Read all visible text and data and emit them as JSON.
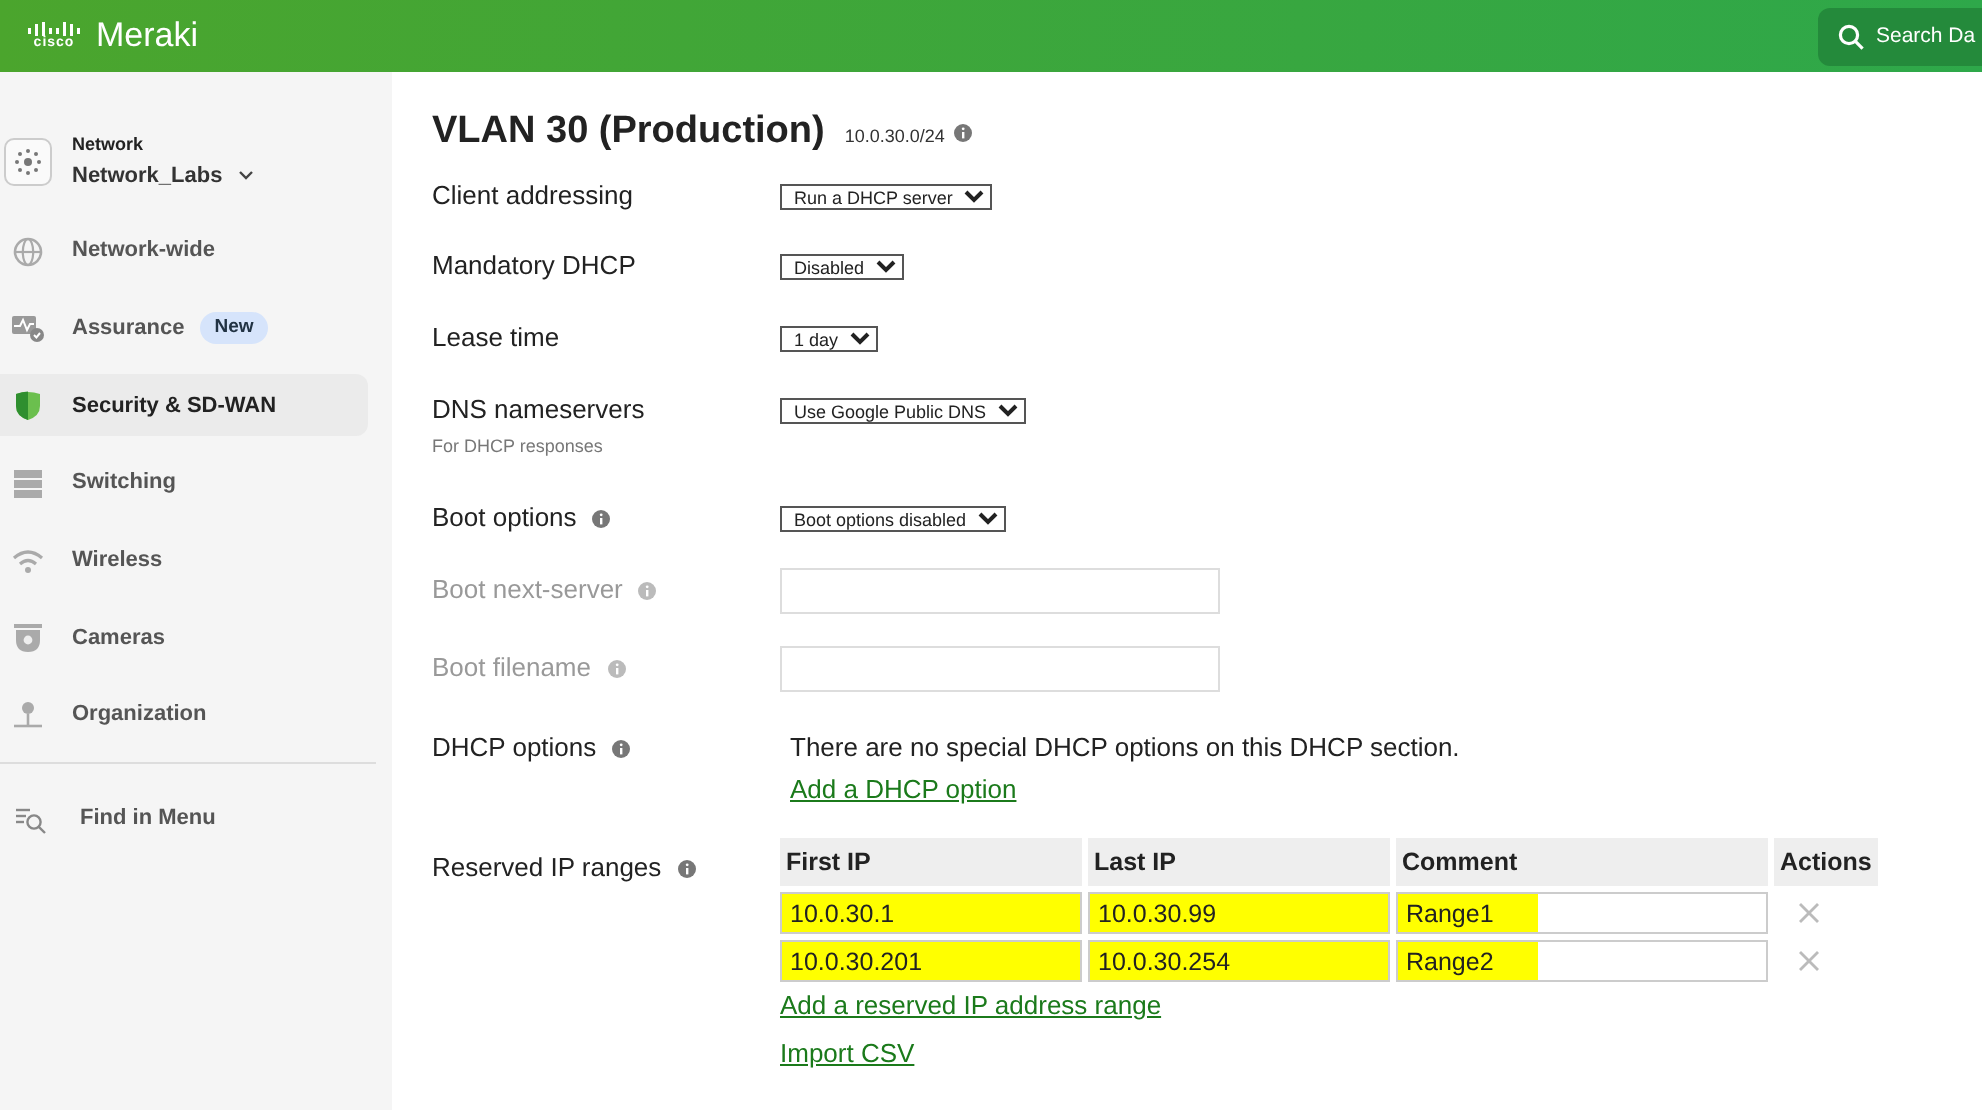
{
  "header": {
    "logo_mark": "cisco",
    "logo_name": "Meraki",
    "search": {
      "placeholder": "Search Da"
    }
  },
  "sidebar": {
    "network": {
      "label": "Network",
      "name": "Network_Labs"
    },
    "items": [
      {
        "label": "Network-wide",
        "selected": false
      },
      {
        "label": "Assurance",
        "selected": false,
        "badge": "New"
      },
      {
        "label": "Security & SD-WAN",
        "selected": true
      },
      {
        "label": "Switching",
        "selected": false
      },
      {
        "label": "Wireless",
        "selected": false
      },
      {
        "label": "Cameras",
        "selected": false
      },
      {
        "label": "Organization",
        "selected": false
      }
    ],
    "find": "Find in Menu"
  },
  "page": {
    "title": "VLAN 30 (Production)",
    "subnet": "10.0.30.0/24",
    "fields": [
      {
        "kind": "select",
        "label": "Client addressing",
        "value": "Run a DHCP server",
        "info": false,
        "disabled": false
      },
      {
        "kind": "select",
        "label": "Mandatory DHCP",
        "value": "Disabled",
        "info": false,
        "disabled": false
      },
      {
        "kind": "select",
        "label": "Lease time",
        "value": "1 day",
        "info": false,
        "disabled": false
      },
      {
        "kind": "select",
        "label": "DNS nameservers",
        "hint": "For DHCP responses",
        "value": "Use Google Public DNS",
        "info": false,
        "disabled": false
      },
      {
        "kind": "select",
        "label": "Boot options",
        "value": "Boot options disabled",
        "info": true,
        "disabled": false
      },
      {
        "kind": "text",
        "label": "Boot next-server",
        "info": true,
        "disabled": true
      },
      {
        "kind": "text",
        "label": "Boot filename",
        "info": true,
        "disabled": true
      },
      {
        "kind": "note",
        "label": "DHCP options",
        "info": true,
        "disabled": false,
        "text": "There are no special DHCP options on this DHCP section.",
        "links": [
          "Add a DHCP option"
        ]
      },
      {
        "kind": "ranges",
        "label": "Reserved IP ranges",
        "info": true,
        "disabled": false,
        "columns": [
          "First IP",
          "Last IP",
          "Comment",
          "Actions"
        ],
        "rows": [
          {
            "first": "10.0.30.1",
            "last": "10.0.30.99",
            "comment": "Range1",
            "highlighted": true
          },
          {
            "first": "10.0.30.201",
            "last": "10.0.30.254",
            "comment": "Range2",
            "highlighted": true
          }
        ],
        "links": [
          "Add a reserved IP address range",
          "Import CSV"
        ]
      }
    ]
  }
}
